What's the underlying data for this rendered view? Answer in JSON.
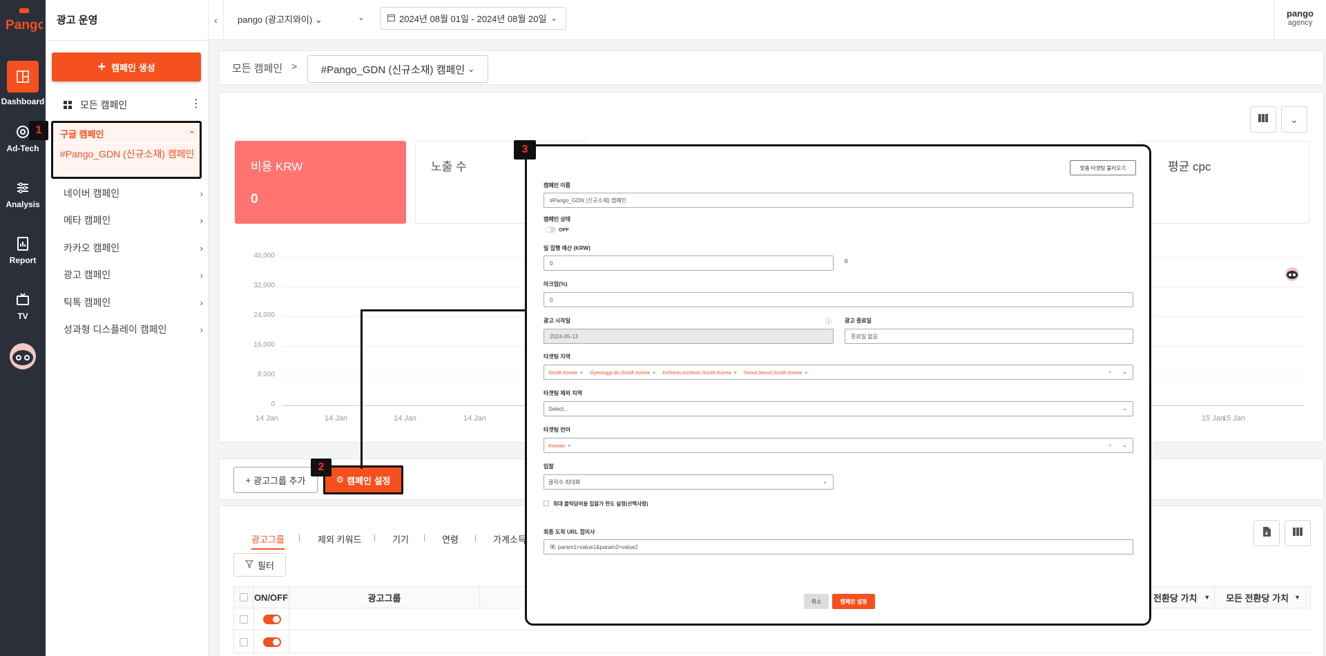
{
  "rail": {
    "logo_text": "Pango",
    "items": [
      {
        "label": "Dashboard",
        "icon": "dashboard-icon"
      },
      {
        "label": "Ad-Tech",
        "icon": "target-icon"
      },
      {
        "label": "Analysis",
        "icon": "sliders-icon"
      },
      {
        "label": "Report",
        "icon": "report-icon"
      },
      {
        "label": "TV",
        "icon": "tv-icon"
      }
    ]
  },
  "sidebar": {
    "title": "광고 운영",
    "create_label": "캠페인 생성",
    "all_campaigns": "모든 캠페인",
    "google_label": "구글 캠페인",
    "google_sub": "#Pango_GDN (신규소재) 캠페인",
    "items": [
      "네이버 캠페인",
      "메타 캠페인",
      "카카오 캠페인",
      "광고 캠페인",
      "틱톡 캠페인",
      "성과형 디스플레이 캠페인"
    ]
  },
  "topbar": {
    "account": "pango (광고지와이)",
    "date_range": "2024년 08월 01일 - 2024년 08월 20일",
    "user_name": "pango",
    "user_role": "agency"
  },
  "breadcrumb": {
    "root": "모든 캠페인",
    "sep": ">",
    "current": "#Pango_GDN (신규소재) 캠페인"
  },
  "kpis": {
    "cost_label": "비용 KRW",
    "cost_value": "0",
    "imp_label": "노출 수",
    "cpc_label": "평균 cpc"
  },
  "chart_data": {
    "type": "line",
    "yticks": [
      "40,000",
      "32,000",
      "24,000",
      "16,000",
      "8,000",
      "0"
    ],
    "xticks_left": [
      "14 Jan",
      "14 Jan",
      "14 Jan",
      "14 Jan"
    ],
    "xticks_right": [
      "15 Jan",
      "15 Jan"
    ],
    "ylim": [
      0,
      40000
    ],
    "series": []
  },
  "actions": {
    "add_group": "광고그룹 추가",
    "campaign_settings": "캠페인 설정"
  },
  "table": {
    "tabs": [
      "광고그룹",
      "제외 키워드",
      "기기",
      "연령",
      "가계소득"
    ],
    "filter_label": "필터",
    "headers": {
      "onoff": "ON/OFF",
      "group": "광고그룹",
      "value_per_conv": "전환당 가치",
      "all_value_per_conv": "모든 전환당 가치"
    }
  },
  "badges": [
    "1",
    "2",
    "3"
  ],
  "modal": {
    "load_targeting": "맞춤 타겟팅 불러오기",
    "name_label": "캠페인 이름",
    "name_value": "#Pango_GDN (신규소재) 캠페인",
    "status_label": "캠페인 상태",
    "status_value": "OFF",
    "budget_label": "일 집행 예산 (KRW)",
    "budget_value": "0",
    "budget_side": "0",
    "markup_label": "마크업(%)",
    "markup_value": "0",
    "start_label": "광고 시작일",
    "start_value": "2024-05-13",
    "end_label": "광고 종료일",
    "end_value": "종료일 없음",
    "region_label": "타겟팅 지역",
    "regions": [
      "South Korea",
      "Gyeonggi-do,South Korea",
      "Incheon,Incheon,South Korea",
      "Seoul,Seoul,South Korea"
    ],
    "exclude_label": "타겟팅 제외 지역",
    "exclude_placeholder": "Select...",
    "lang_label": "타겟팅 언어",
    "languages": [
      "Korean"
    ],
    "bid_label": "입찰",
    "bid_value": "클릭수 최대화",
    "maxcpc_label": "최대 클릭당비용 입찰가 한도 설정(선택사항)",
    "url_label": "최종 도착 URL 접미사",
    "url_placeholder": "예: param1=value1&param2=value2",
    "cancel": "취소",
    "submit": "캠페인 설정"
  }
}
